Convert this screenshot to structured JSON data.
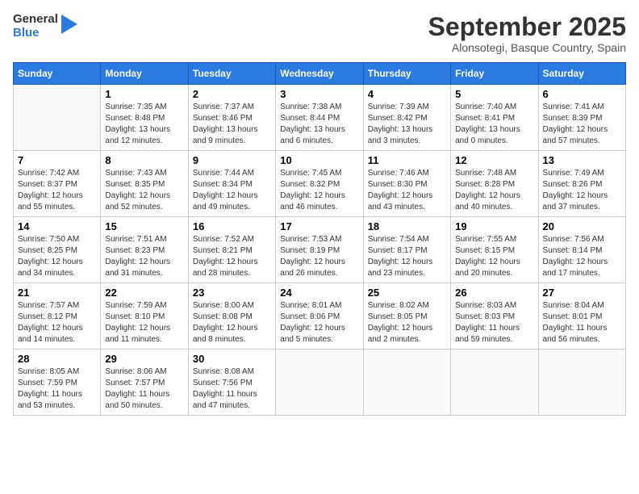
{
  "header": {
    "logo_line1": "General",
    "logo_line2": "Blue",
    "month": "September 2025",
    "location": "Alonsotegi, Basque Country, Spain"
  },
  "weekdays": [
    "Sunday",
    "Monday",
    "Tuesday",
    "Wednesday",
    "Thursday",
    "Friday",
    "Saturday"
  ],
  "weeks": [
    [
      {
        "day": "",
        "info": ""
      },
      {
        "day": "1",
        "info": "Sunrise: 7:35 AM\nSunset: 8:48 PM\nDaylight: 13 hours\nand 12 minutes."
      },
      {
        "day": "2",
        "info": "Sunrise: 7:37 AM\nSunset: 8:46 PM\nDaylight: 13 hours\nand 9 minutes."
      },
      {
        "day": "3",
        "info": "Sunrise: 7:38 AM\nSunset: 8:44 PM\nDaylight: 13 hours\nand 6 minutes."
      },
      {
        "day": "4",
        "info": "Sunrise: 7:39 AM\nSunset: 8:42 PM\nDaylight: 13 hours\nand 3 minutes."
      },
      {
        "day": "5",
        "info": "Sunrise: 7:40 AM\nSunset: 8:41 PM\nDaylight: 13 hours\nand 0 minutes."
      },
      {
        "day": "6",
        "info": "Sunrise: 7:41 AM\nSunset: 8:39 PM\nDaylight: 12 hours\nand 57 minutes."
      }
    ],
    [
      {
        "day": "7",
        "info": "Sunrise: 7:42 AM\nSunset: 8:37 PM\nDaylight: 12 hours\nand 55 minutes."
      },
      {
        "day": "8",
        "info": "Sunrise: 7:43 AM\nSunset: 8:35 PM\nDaylight: 12 hours\nand 52 minutes."
      },
      {
        "day": "9",
        "info": "Sunrise: 7:44 AM\nSunset: 8:34 PM\nDaylight: 12 hours\nand 49 minutes."
      },
      {
        "day": "10",
        "info": "Sunrise: 7:45 AM\nSunset: 8:32 PM\nDaylight: 12 hours\nand 46 minutes."
      },
      {
        "day": "11",
        "info": "Sunrise: 7:46 AM\nSunset: 8:30 PM\nDaylight: 12 hours\nand 43 minutes."
      },
      {
        "day": "12",
        "info": "Sunrise: 7:48 AM\nSunset: 8:28 PM\nDaylight: 12 hours\nand 40 minutes."
      },
      {
        "day": "13",
        "info": "Sunrise: 7:49 AM\nSunset: 8:26 PM\nDaylight: 12 hours\nand 37 minutes."
      }
    ],
    [
      {
        "day": "14",
        "info": "Sunrise: 7:50 AM\nSunset: 8:25 PM\nDaylight: 12 hours\nand 34 minutes."
      },
      {
        "day": "15",
        "info": "Sunrise: 7:51 AM\nSunset: 8:23 PM\nDaylight: 12 hours\nand 31 minutes."
      },
      {
        "day": "16",
        "info": "Sunrise: 7:52 AM\nSunset: 8:21 PM\nDaylight: 12 hours\nand 28 minutes."
      },
      {
        "day": "17",
        "info": "Sunrise: 7:53 AM\nSunset: 8:19 PM\nDaylight: 12 hours\nand 26 minutes."
      },
      {
        "day": "18",
        "info": "Sunrise: 7:54 AM\nSunset: 8:17 PM\nDaylight: 12 hours\nand 23 minutes."
      },
      {
        "day": "19",
        "info": "Sunrise: 7:55 AM\nSunset: 8:15 PM\nDaylight: 12 hours\nand 20 minutes."
      },
      {
        "day": "20",
        "info": "Sunrise: 7:56 AM\nSunset: 8:14 PM\nDaylight: 12 hours\nand 17 minutes."
      }
    ],
    [
      {
        "day": "21",
        "info": "Sunrise: 7:57 AM\nSunset: 8:12 PM\nDaylight: 12 hours\nand 14 minutes."
      },
      {
        "day": "22",
        "info": "Sunrise: 7:59 AM\nSunset: 8:10 PM\nDaylight: 12 hours\nand 11 minutes."
      },
      {
        "day": "23",
        "info": "Sunrise: 8:00 AM\nSunset: 8:08 PM\nDaylight: 12 hours\nand 8 minutes."
      },
      {
        "day": "24",
        "info": "Sunrise: 8:01 AM\nSunset: 8:06 PM\nDaylight: 12 hours\nand 5 minutes."
      },
      {
        "day": "25",
        "info": "Sunrise: 8:02 AM\nSunset: 8:05 PM\nDaylight: 12 hours\nand 2 minutes."
      },
      {
        "day": "26",
        "info": "Sunrise: 8:03 AM\nSunset: 8:03 PM\nDaylight: 11 hours\nand 59 minutes."
      },
      {
        "day": "27",
        "info": "Sunrise: 8:04 AM\nSunset: 8:01 PM\nDaylight: 11 hours\nand 56 minutes."
      }
    ],
    [
      {
        "day": "28",
        "info": "Sunrise: 8:05 AM\nSunset: 7:59 PM\nDaylight: 11 hours\nand 53 minutes."
      },
      {
        "day": "29",
        "info": "Sunrise: 8:06 AM\nSunset: 7:57 PM\nDaylight: 11 hours\nand 50 minutes."
      },
      {
        "day": "30",
        "info": "Sunrise: 8:08 AM\nSunset: 7:56 PM\nDaylight: 11 hours\nand 47 minutes."
      },
      {
        "day": "",
        "info": ""
      },
      {
        "day": "",
        "info": ""
      },
      {
        "day": "",
        "info": ""
      },
      {
        "day": "",
        "info": ""
      }
    ]
  ]
}
